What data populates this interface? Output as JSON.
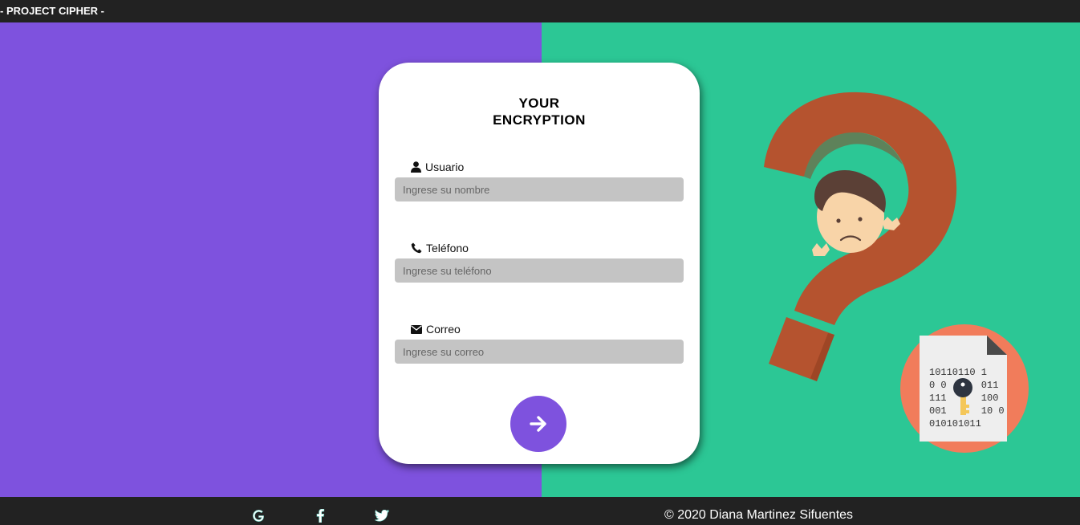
{
  "header": {
    "brand": "- PROJECT CIPHER -"
  },
  "form": {
    "title_line1": "YOUR",
    "title_line2": "ENCRYPTION",
    "fields": [
      {
        "label": "Usuario",
        "icon": "user-icon",
        "placeholder": "Ingrese su nombre",
        "value": ""
      },
      {
        "label": "Teléfono",
        "icon": "phone-icon",
        "placeholder": "Ingrese su teléfono",
        "value": ""
      },
      {
        "label": "Correo",
        "icon": "envelope-icon",
        "placeholder": "Ingrese su correo",
        "value": ""
      }
    ],
    "submit_icon": "arrow-right-icon"
  },
  "illustration": {
    "binary_lines": [
      "10110110 1",
      "0 0      011",
      "111      100",
      "001      10 0",
      "010101011"
    ]
  },
  "footer": {
    "social": [
      "google-icon",
      "facebook-icon",
      "twitter-icon"
    ],
    "copyright": "© 2020 Diana Martinez Sifuentes"
  },
  "colors": {
    "left_panel": "#7e52de",
    "right_panel": "#2cc795",
    "bars": "#222222",
    "input_bg": "#c4c4c4",
    "question_mark": "#b5532f",
    "document_circle": "#f17c5b"
  }
}
